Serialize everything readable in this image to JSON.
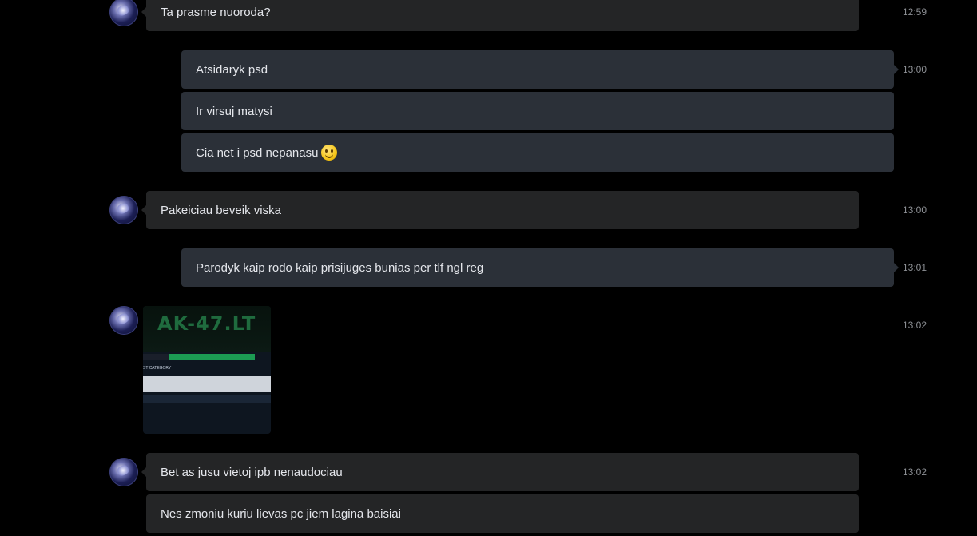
{
  "messages": [
    {
      "text": "Ta prasme nuoroda?",
      "time": "12:59"
    },
    {
      "text": "Atsidaryk psd",
      "time": "13:00"
    },
    {
      "text": "Ir virsuj matysi"
    },
    {
      "text": "Cia net i psd nepanasu"
    },
    {
      "text": "Pakeiciau beveik viska",
      "time": "13:00"
    },
    {
      "text": "Parodyk kaip rodo kaip prisijuges bunias per tlf ngl reg",
      "time": "13:01"
    },
    {
      "time": "13:02",
      "image": {
        "logo": "AK-47.LT",
        "category": "ST CATEGORY"
      }
    },
    {
      "text": "Bet as jusu vietoj ipb nenaudociau",
      "time": "13:02"
    },
    {
      "text": "Nes zmoniu kuriu lievas pc jiem lagina baisiai"
    }
  ],
  "colors": {
    "background": "#000000",
    "incoming_bubble": "#242526",
    "outgoing_bubble": "#2b3038",
    "text": "#e4e6eb",
    "timestamp": "#8c8f94"
  },
  "emoji": "slightly-smiling-face-icon"
}
